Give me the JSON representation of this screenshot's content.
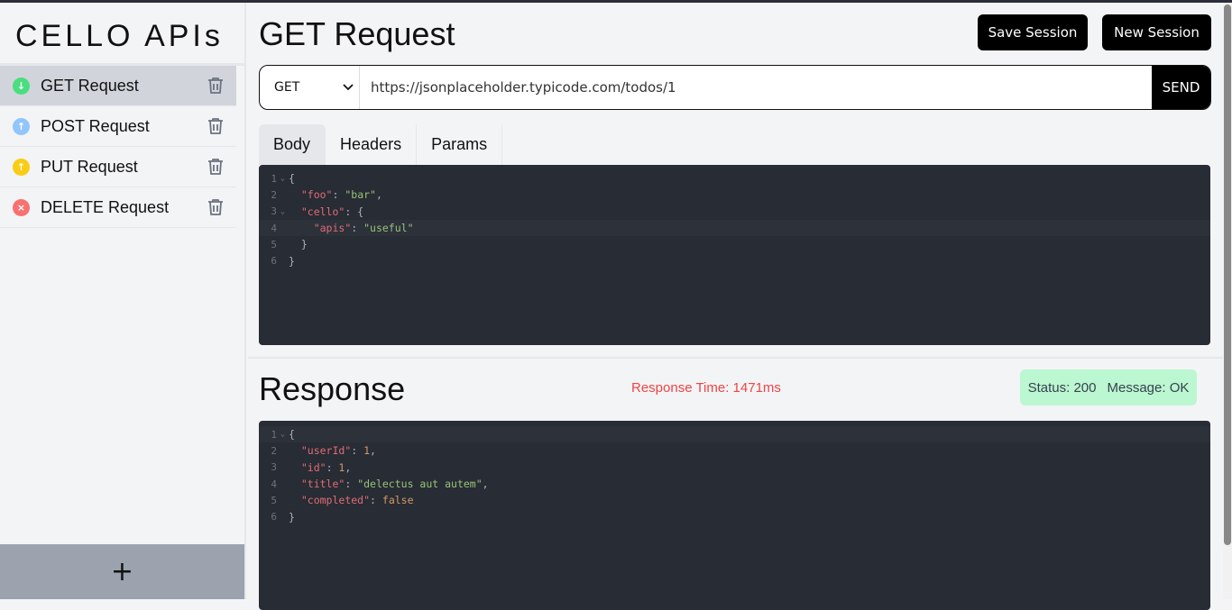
{
  "app": {
    "title": "CELLO APIs"
  },
  "sidebar": {
    "items": [
      {
        "label": "GET Request",
        "method": "GET",
        "icon": "arrow-down-circle-icon",
        "color": "#4ade80",
        "glyph": "↓",
        "active": true
      },
      {
        "label": "POST Request",
        "method": "POST",
        "icon": "arrow-up-circle-icon",
        "color": "#93c5fd",
        "glyph": "↑",
        "active": false
      },
      {
        "label": "PUT Request",
        "method": "PUT",
        "icon": "arrow-up-circle-icon",
        "color": "#facc15",
        "glyph": "↑",
        "active": false
      },
      {
        "label": "DELETE Request",
        "method": "DELETE",
        "icon": "x-circle-icon",
        "color": "#f87171",
        "glyph": "×",
        "active": false
      }
    ],
    "add_label": "+"
  },
  "header": {
    "title": "GET Request",
    "save_label": "Save Session",
    "new_label": "New Session"
  },
  "request": {
    "method": "GET",
    "url": "https://jsonplaceholder.typicode.com/todos/1",
    "send_label": "SEND"
  },
  "tabs": [
    {
      "label": "Body",
      "active": true
    },
    {
      "label": "Headers"
    },
    {
      "label": "Params"
    }
  ],
  "body_lines": [
    [
      [
        "p",
        "{"
      ]
    ],
    [
      [
        "p",
        "  "
      ],
      [
        "k",
        "\"foo\""
      ],
      [
        "p",
        ": "
      ],
      [
        "s",
        "\"bar\""
      ],
      [
        "p",
        ","
      ]
    ],
    [
      [
        "p",
        "  "
      ],
      [
        "k",
        "\"cello\""
      ],
      [
        "p",
        ": {"
      ]
    ],
    [
      [
        "p",
        "    "
      ],
      [
        "k",
        "\"apis\""
      ],
      [
        "p",
        ": "
      ],
      [
        "s",
        "\"useful\""
      ]
    ],
    [
      [
        "p",
        "  }"
      ]
    ],
    [
      [
        "p",
        "}"
      ]
    ]
  ],
  "response": {
    "title": "Response",
    "time_text": "Response Time: 1471ms",
    "status_text": "Status: 200",
    "message_text": "Message: OK",
    "status_color": "#bbf7d0",
    "lines": [
      [
        [
          "p",
          "{"
        ]
      ],
      [
        [
          "p",
          "  "
        ],
        [
          "k",
          "\"userId\""
        ],
        [
          "p",
          ": "
        ],
        [
          "n",
          "1"
        ],
        [
          "p",
          ","
        ]
      ],
      [
        [
          "p",
          "  "
        ],
        [
          "k",
          "\"id\""
        ],
        [
          "p",
          ": "
        ],
        [
          "n",
          "1"
        ],
        [
          "p",
          ","
        ]
      ],
      [
        [
          "p",
          "  "
        ],
        [
          "k",
          "\"title\""
        ],
        [
          "p",
          ": "
        ],
        [
          "s",
          "\"delectus aut autem\""
        ],
        [
          "p",
          ","
        ]
      ],
      [
        [
          "p",
          "  "
        ],
        [
          "k",
          "\"completed\""
        ],
        [
          "p",
          ": "
        ],
        [
          "n",
          "false"
        ]
      ],
      [
        [
          "p",
          "}"
        ]
      ]
    ]
  }
}
